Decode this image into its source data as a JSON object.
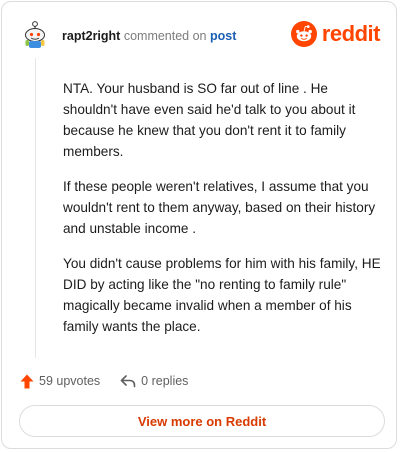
{
  "header": {
    "username": "rapt2right",
    "action_text": "commented on",
    "post_link": "post",
    "brand": "reddit"
  },
  "comment": {
    "paragraphs": [
      "NTA. Your husband is SO far out of line . He shouldn't have even said he'd talk to you about it because he knew that you don't rent it to family members.",
      "If these people weren't relatives, I assume that you wouldn't rent to them anyway, based on their history and unstable income .",
      "You didn't cause problems for him with his family, HE DID by acting like the \"no renting to family rule\" magically became invalid when a member of his family wants the place."
    ]
  },
  "actions": {
    "upvotes": "59 upvotes",
    "replies": "0 replies"
  },
  "view_more_label": "View more on Reddit",
  "colors": {
    "brand": "#ff4500",
    "upvote": "#ff4500",
    "link": "#1a5fb4",
    "view_more": "#d93a00"
  },
  "icons": [
    "user-avatar",
    "reddit-snoo-icon",
    "upvote-arrow-icon",
    "reply-icon"
  ]
}
